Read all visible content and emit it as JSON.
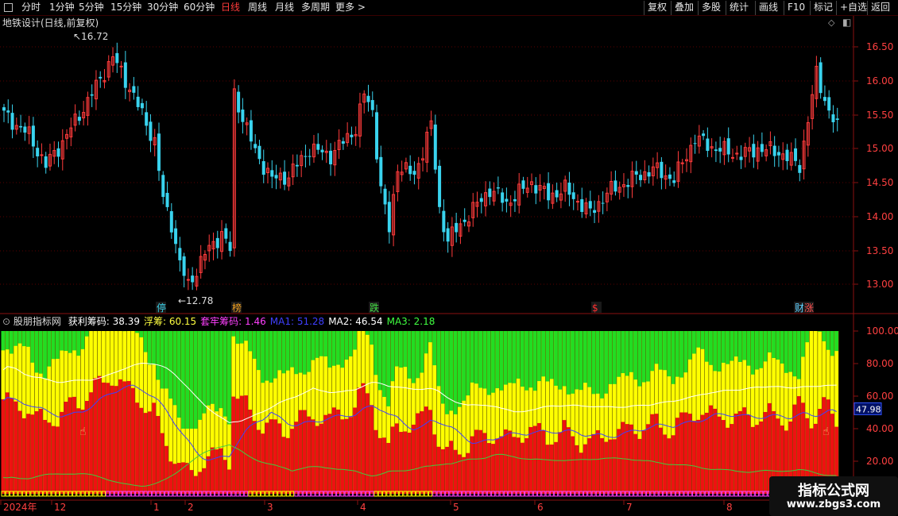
{
  "toolbar": {
    "left": [
      "分时",
      "1分钟",
      "5分钟",
      "15分钟",
      "30分钟",
      "60分钟",
      "日线",
      "周线",
      "月线",
      "多周期",
      "更多 >"
    ],
    "active": "日线",
    "right": [
      "复权",
      "叠加",
      "多股",
      "统计",
      "画线",
      "F10",
      "标记",
      "+自选",
      "返回"
    ]
  },
  "main": {
    "title": "地铁设计(日线,前复权)",
    "high_label": "16.72",
    "low_label": "12.78",
    "price_ticks": [
      "16.50",
      "16.00",
      "15.50",
      "15.00",
      "14.50",
      "14.00",
      "13.50",
      "13.00"
    ],
    "markers": [
      {
        "text": "停",
        "color": "#3ad1e8"
      },
      {
        "text": "榜",
        "color": "#f0a020"
      },
      {
        "text": "跌",
        "color": "#44dd44"
      },
      {
        "text": "$",
        "color": "#ff3030"
      },
      {
        "text": "财",
        "color": "#5fd1ff"
      },
      {
        "text": "涨",
        "color": "#ff5050"
      }
    ]
  },
  "indicator": {
    "name": "股朋指标网",
    "items": [
      {
        "label": "获利筹码:",
        "value": "38.39",
        "color": "#ffffff"
      },
      {
        "label": "浮筹:",
        "value": "60.15",
        "color": "#ffff40"
      },
      {
        "label": "套牢筹码:",
        "value": "1.46",
        "color": "#ff40ff"
      },
      {
        "label": "MA1:",
        "value": "51.28",
        "color": "#3f3fff"
      },
      {
        "label": "MA2:",
        "value": "46.54",
        "color": "#ffffff"
      },
      {
        "label": "MA3:",
        "value": "2.18",
        "color": "#40ff40"
      }
    ],
    "y_ticks": [
      "100.00",
      "80.00",
      "60.00",
      "40.00",
      "20.00"
    ],
    "current_value": "47.98"
  },
  "xaxis": {
    "labels": [
      "2024年",
      "12",
      "1",
      "2",
      "3",
      "4",
      "5",
      "6",
      "7",
      "8"
    ]
  },
  "watermark": {
    "line1": "指标公式网",
    "line2": "www.zbgs3.com"
  },
  "colors": {
    "up": "#ff3b3b",
    "down": "#39d3ee",
    "red_area": "#ee1111",
    "yellow_area": "#ffff00",
    "green_area": "#22dd22"
  }
}
